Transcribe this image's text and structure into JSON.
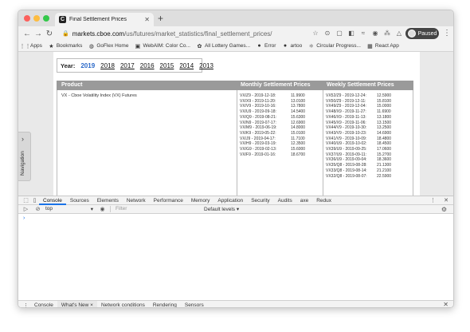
{
  "browser": {
    "tab_title": "Final Settlement Prices",
    "tab_favicon": "C",
    "url_host": "markets.cboe.com",
    "url_path": "/us/futures/market_statistics/final_settlement_prices/",
    "profile_status": "Paused"
  },
  "bookmarks": [
    {
      "label": "Apps",
      "icon": "apps-grid-icon"
    },
    {
      "label": "Bookmarks",
      "icon": "star-icon"
    },
    {
      "label": "GoFlex Home",
      "icon": "globe-icon"
    },
    {
      "label": "WebAIM: Color Co...",
      "icon": "webaim-icon"
    },
    {
      "label": "All Lottery Games...",
      "icon": "lottery-icon"
    },
    {
      "label": "Error",
      "icon": "github-icon"
    },
    {
      "label": "artoo",
      "icon": "github-icon"
    },
    {
      "label": "Circular Progress...",
      "icon": "react-icon"
    },
    {
      "label": "React App",
      "icon": "app-icon"
    }
  ],
  "page": {
    "year_label": "Year:",
    "years": [
      "2019",
      "2018",
      "2017",
      "2016",
      "2015",
      "2014",
      "2013"
    ],
    "selected_year": "2019",
    "columns": [
      "Product",
      "Monthly Settlement Prices",
      "Weekly Settlement Prices"
    ],
    "product": "VX - Cboe Volatility Index (VX) Futures",
    "monthly": [
      {
        "label": "VX/Z9 - 2019-12-18:",
        "value": "11.9900"
      },
      {
        "label": "VX/X9 - 2019-11-20:",
        "value": "13.0100"
      },
      {
        "label": "VX/V9 - 2019-10-16:",
        "value": "13.7800"
      },
      {
        "label": "VX/U9 - 2019-09-18:",
        "value": "14.5400"
      },
      {
        "label": "VX/Q9 - 2019-08-21:",
        "value": "15.6300"
      },
      {
        "label": "VX/N9 - 2019-07-17:",
        "value": "12.6900"
      },
      {
        "label": "VX/M9 - 2019-06-19:",
        "value": "14.8000"
      },
      {
        "label": "VX/K9 - 2019-05-22:",
        "value": "15.0100"
      },
      {
        "label": "VX/J9 - 2019-04-17:",
        "value": "11.7100"
      },
      {
        "label": "VX/H9 - 2019-03-19:",
        "value": "12.3500"
      },
      {
        "label": "VX/G9 - 2019-02-13:",
        "value": "15.6000"
      },
      {
        "label": "VX/F9 - 2019-01-16:",
        "value": "18.6700"
      }
    ],
    "weekly": [
      {
        "label": "VX52/Z9 - 2019-12-24:",
        "value": "12.5900"
      },
      {
        "label": "VX50/Z9 - 2019-12-11:",
        "value": "15.8100"
      },
      {
        "label": "VX49/Z9 - 2019-12-04:",
        "value": "15.0000"
      },
      {
        "label": "VX48/X9 - 2019-11-27:",
        "value": "11.6900"
      },
      {
        "label": "VX46/X9 - 2019-11-13:",
        "value": "13.1800"
      },
      {
        "label": "VX45/X9 - 2019-11-06:",
        "value": "13.1500"
      },
      {
        "label": "VX44/V9 - 2019-10-30:",
        "value": "13.2500"
      },
      {
        "label": "VX43/V9 - 2019-10-23:",
        "value": "14.6900"
      },
      {
        "label": "VX41/V9 - 2019-10-09:",
        "value": "18.4800"
      },
      {
        "label": "VX40/U9 - 2019-10-02:",
        "value": "18.4500"
      },
      {
        "label": "VX39/U9 - 2019-09-25:",
        "value": "17.0600"
      },
      {
        "label": "VX37/U9 - 2019-09-11:",
        "value": "15.2700"
      },
      {
        "label": "VX36/U9 - 2019-09-04:",
        "value": "18.3600"
      },
      {
        "label": "VX35/Q8 - 2019-08-28:",
        "value": "21.1300"
      },
      {
        "label": "VX33/Q8 - 2019-08-14:",
        "value": "21.2100"
      },
      {
        "label": "VX32/Q8 - 2019-08-07:",
        "value": "22.5900"
      }
    ],
    "side_nav_label": "Navigation"
  },
  "devtools": {
    "tabs": [
      "Console",
      "Sources",
      "Elements",
      "Network",
      "Performance",
      "Memory",
      "Application",
      "Security",
      "Audits",
      "axe",
      "Redux"
    ],
    "active_tab": "Console",
    "context": "top",
    "filter_placeholder": "Filter",
    "levels": "Default levels ▾",
    "prompt": "›",
    "drawer_tabs": [
      "Console",
      "What's New ×",
      "Network conditions",
      "Rendering",
      "Sensors"
    ],
    "drawer_active": "What's New ×"
  }
}
